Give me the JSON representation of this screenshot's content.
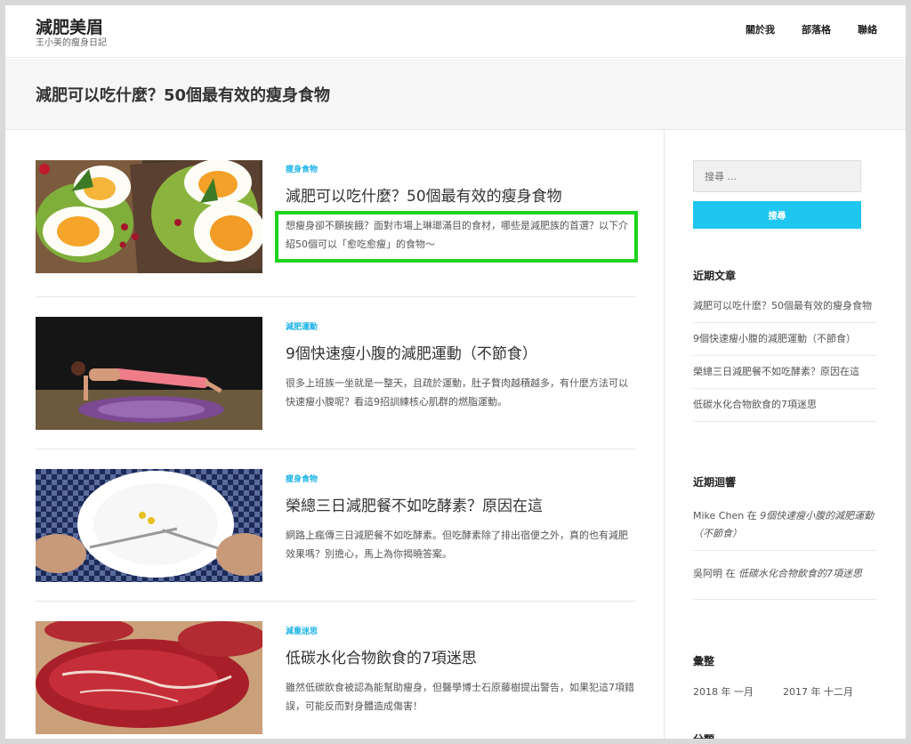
{
  "site": {
    "title": "減肥美眉",
    "description": "王小美的瘦身日記"
  },
  "nav": [
    "關於我",
    "部落格",
    "聯絡"
  ],
  "page_title": "減肥可以吃什麼？50個最有效的瘦身食物",
  "posts": [
    {
      "category": "瘦身食物",
      "title": "減肥可以吃什麼？50個最有效的瘦身食物",
      "excerpt": "想瘦身卻不願挨餓？面對市場上琳瑯滿目的食材，哪些是減肥族的首選？以下介紹50個可以「愈吃愈瘦」的食物～"
    },
    {
      "category": "減肥運動",
      "title": "9個快速瘦小腹的減肥運動（不節食）",
      "excerpt": "很多上班族一坐就是一整天，且疏於運動，肚子贅肉越積越多，有什麼方法可以快速瘦小腹呢？看這9招訓練核心肌群的燃脂運動。"
    },
    {
      "category": "瘦身食物",
      "title": "榮總三日減肥餐不如吃酵素？原因在這",
      "excerpt": "網路上瘋傳三日減肥餐不如吃酵素。但吃酵素除了排出宿便之外，真的也有減肥效果嗎？別擔心，馬上為你揭曉答案。"
    },
    {
      "category": "減重迷思",
      "title": "低碳水化合物飲食的7項迷思",
      "excerpt": "雖然低碳飲食被認為能幫助瘦身，但醫學博士石原藤樹提出警告，如果犯這7項錯誤，可能反而對身體造成傷害！"
    }
  ],
  "sidebar": {
    "search_placeholder": "搜尋 ...",
    "search_button": "搜尋",
    "recent_posts_title": "近期文章",
    "recent_posts": [
      "減肥可以吃什麼？50個最有效的瘦身食物",
      "9個快速瘦小腹的減肥運動（不節食）",
      "榮總三日減肥餐不如吃酵素？原因在這",
      "低碳水化合物飲食的7項迷思"
    ],
    "recent_comments_title": "近期迴響",
    "recent_comments": [
      {
        "author": "Mike Chen",
        "on": "在",
        "post": "9個快速瘦小腹的減肥運動（不節食）"
      },
      {
        "author": "吳阿明",
        "on": "在",
        "post": "低碳水化合物飲食的7項迷思"
      }
    ],
    "archives_title": "彙整",
    "archives": [
      "2018 年 一月",
      "2017 年 十二月"
    ],
    "categories_title": "分類"
  },
  "colors": {
    "accent": "#1fb4e6",
    "button": "#1fc6f0",
    "highlight": "#1dd31d"
  }
}
